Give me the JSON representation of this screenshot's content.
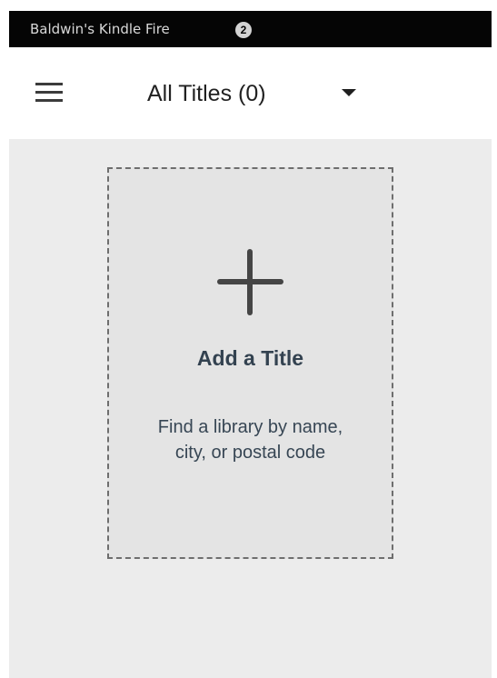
{
  "status_bar": {
    "device_name": "Baldwin's Kindle Fire",
    "notification_count": "2"
  },
  "app_bar": {
    "menu_icon": "hamburger-menu-icon",
    "filter_label": "All Titles (0)",
    "dropdown_icon": "dropdown-arrow-icon"
  },
  "add_card": {
    "icon": "plus-icon",
    "title": "Add a Title",
    "subtitle_line1": "Find a library by name,",
    "subtitle_line2": "city, or postal code"
  },
  "colors": {
    "status_bar_bg": "#050505",
    "app_bar_bg": "#ffffff",
    "content_bg": "#ececec",
    "card_bg": "#e4e4e4",
    "card_text": "#334250"
  }
}
